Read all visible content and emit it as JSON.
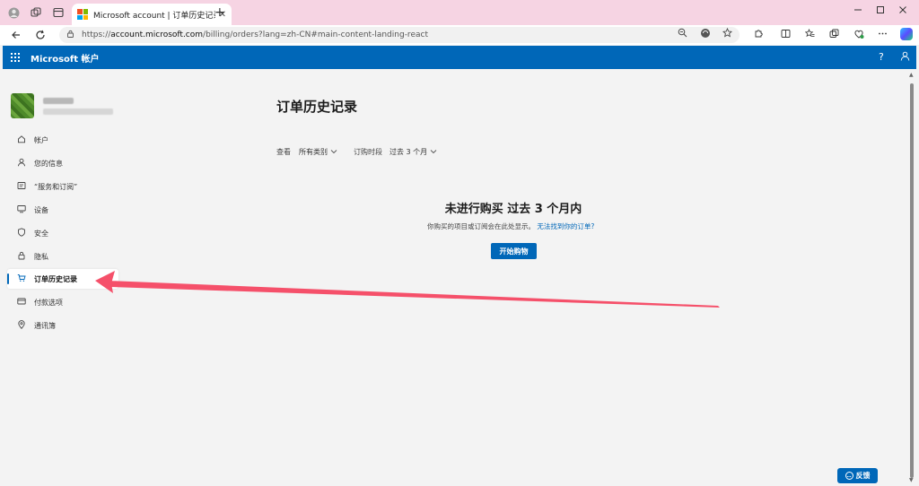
{
  "browser": {
    "tab_title": "Microsoft account | 订单历史记录",
    "tab_close": "✕",
    "new_tab": "+",
    "url_host": "account.microsoft.com",
    "url_prefix": "https://",
    "url_path": "/billing/orders?lang=zh-CN#main-content-landing-react"
  },
  "header": {
    "brand": "Microsoft 帐户",
    "help": "?"
  },
  "sidebar": {
    "items": [
      {
        "label": "帐户",
        "icon": "home-icon"
      },
      {
        "label": "您的信息",
        "icon": "person-icon"
      },
      {
        "label": "“服务和订阅”",
        "icon": "subscriptions-icon"
      },
      {
        "label": "设备",
        "icon": "monitor-icon"
      },
      {
        "label": "安全",
        "icon": "shield-icon"
      },
      {
        "label": "隐私",
        "icon": "lock-icon"
      },
      {
        "label": "订单历史记录",
        "icon": "cart-icon",
        "active": true
      },
      {
        "label": "付款选项",
        "icon": "card-icon"
      },
      {
        "label": "通讯簿",
        "icon": "location-icon"
      }
    ]
  },
  "main": {
    "title": "订单历史记录",
    "filter_view_label": "查看",
    "filter_view_value": "所有类别",
    "filter_period_label": "订购时段",
    "filter_period_value": "过去 3 个月",
    "empty_title": "未进行购买 过去 3 个月内",
    "empty_desc": "你购买的项目或订阅会在此处显示。",
    "empty_link": "无法找到你的订单?",
    "shop_button": "开始购物"
  },
  "feedback_button": "反馈",
  "colors": {
    "brand_blue": "#0067b8",
    "tab_bar": "#f6d4e3",
    "arrow": "#f5506a"
  }
}
